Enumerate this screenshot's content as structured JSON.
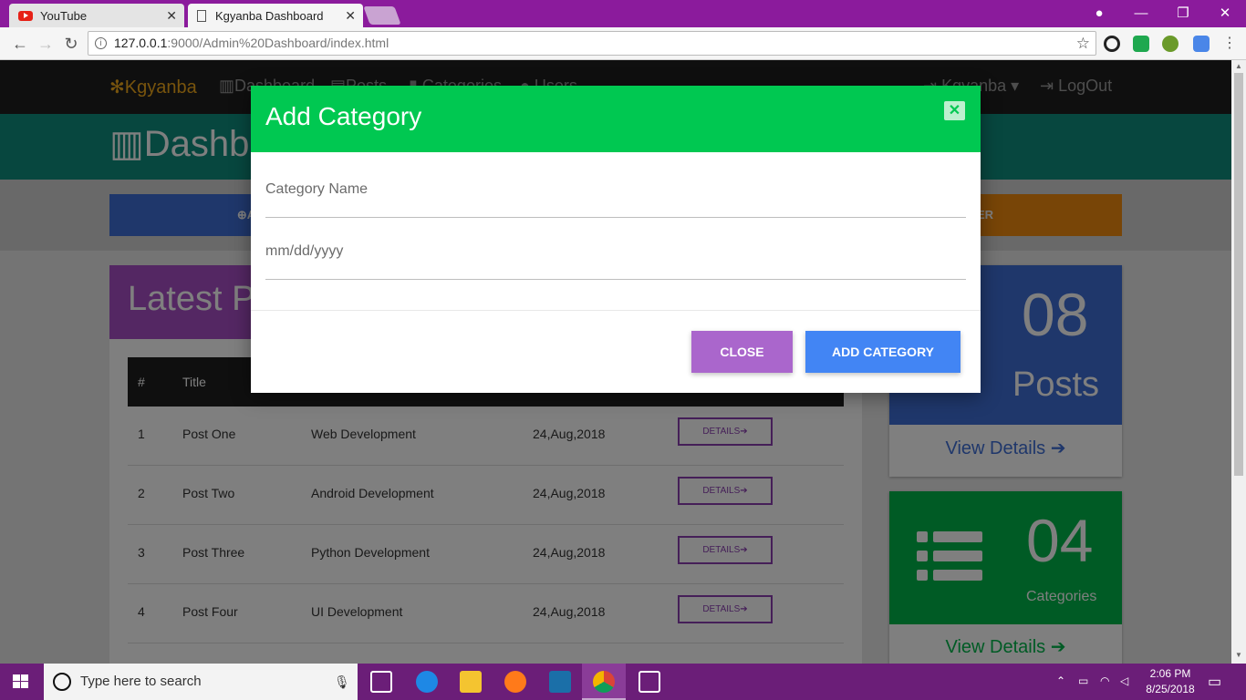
{
  "browser": {
    "tabs": [
      {
        "title": "YouTube",
        "active": false
      },
      {
        "title": "Kgyanba Dashboard",
        "active": true
      }
    ],
    "url_host": "127.0.0.1",
    "url_rest": ":9000/Admin%20Dashboard/index.html"
  },
  "navbar": {
    "brand": "Kgyanba",
    "links": [
      "Dashboard",
      "Posts",
      "Categories",
      "Users"
    ],
    "user": "Kgyanba",
    "logout": "LogOut"
  },
  "header": {
    "title": "Dashb"
  },
  "actions": {
    "left_label": "A",
    "right_label": "ER"
  },
  "latest": {
    "title": "Latest P",
    "columns": [
      "#",
      "Title"
    ],
    "rows": [
      {
        "num": "1",
        "title": "Post One",
        "category": "Web Development",
        "date": "24,Aug,2018",
        "btn": "DETAILS"
      },
      {
        "num": "2",
        "title": "Post Two",
        "category": "Android Development",
        "date": "24,Aug,2018",
        "btn": "DETAILS"
      },
      {
        "num": "3",
        "title": "Post Three",
        "category": "Python Development",
        "date": "24,Aug,2018",
        "btn": "DETAILS"
      },
      {
        "num": "4",
        "title": "Post Four",
        "category": "UI Development",
        "date": "24,Aug,2018",
        "btn": "DETAILS"
      }
    ]
  },
  "stats": {
    "posts": {
      "count": "08",
      "label": "Posts",
      "link": "View Details"
    },
    "categories": {
      "count": "04",
      "label": "Categories",
      "link": "View Details"
    }
  },
  "modal": {
    "title": "Add Category",
    "field_name_placeholder": "Category Name",
    "field_date_placeholder": "mm/dd/yyyy",
    "close_label": "CLOSE",
    "submit_label": "ADD CATEGORY"
  },
  "taskbar": {
    "search_placeholder": "Type here to search",
    "time": "2:06 PM",
    "date": "8/25/2018"
  },
  "colors": {
    "modal_header": "#00c851",
    "close_button": "#aa66cc",
    "submit_button": "#4285f4",
    "posts_card": "#3f6fd6",
    "categories_card": "#00b64a",
    "latest_header": "#a94fc7"
  }
}
